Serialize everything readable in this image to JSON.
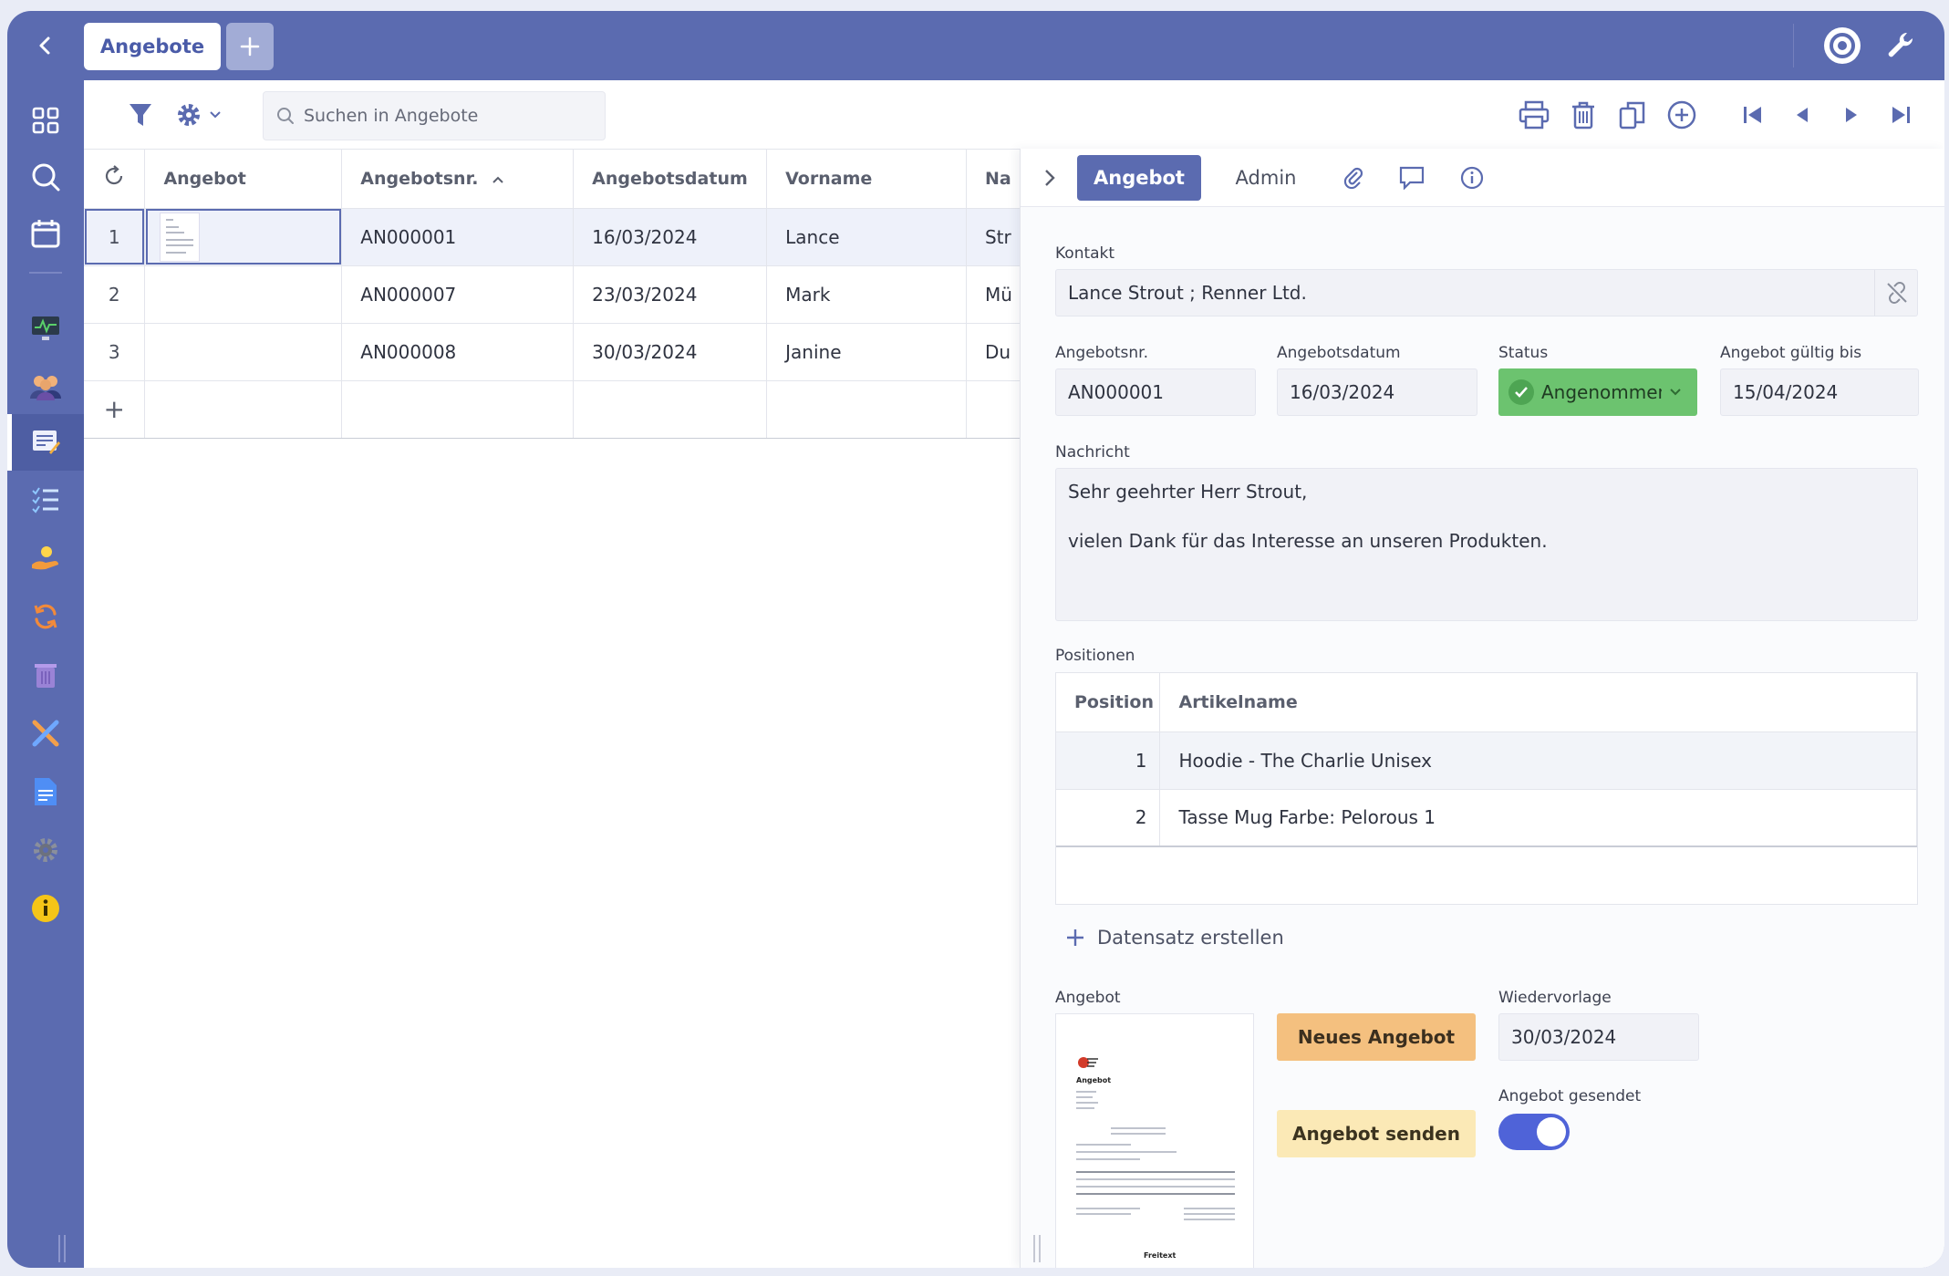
{
  "tabs": {
    "main_label": "Angebote"
  },
  "search": {
    "placeholder": "Suchen in Angebote"
  },
  "grid": {
    "columns": [
      "Angebot",
      "Angebotsnr.",
      "Angebotsdatum",
      "Vorname",
      "Na"
    ],
    "rows": [
      {
        "num": "1",
        "nr": "AN000001",
        "datum": "16/03/2024",
        "vorname": "Lance",
        "nachname": "Str"
      },
      {
        "num": "2",
        "nr": "AN000007",
        "datum": "23/03/2024",
        "vorname": "Mark",
        "nachname": "Mü"
      },
      {
        "num": "3",
        "nr": "AN000008",
        "datum": "30/03/2024",
        "vorname": "Janine",
        "nachname": "Du"
      }
    ],
    "add_symbol": "+"
  },
  "panel": {
    "tabs": {
      "angebot": "Angebot",
      "admin": "Admin"
    },
    "kontakt": {
      "label": "Kontakt",
      "value": "Lance Strout ; Renner Ltd."
    },
    "angebotsnr": {
      "label": "Angebotsnr.",
      "value": "AN000001"
    },
    "angebotsdatum": {
      "label": "Angebotsdatum",
      "value": "16/03/2024"
    },
    "status": {
      "label": "Status",
      "value": "Angenommen"
    },
    "gueltig": {
      "label": "Angebot gültig bis",
      "value": "15/04/2024"
    },
    "nachricht": {
      "label": "Nachricht",
      "line1": "Sehr geehrter Herr Strout,",
      "line2": "vielen Dank für das Interesse an unseren Produkten."
    },
    "positionen": {
      "label": "Positionen",
      "columns": [
        "Position",
        "Artikelname"
      ],
      "rows": [
        {
          "pos": "1",
          "name": "Hoodie - The Charlie Unisex"
        },
        {
          "pos": "2",
          "name": "Tasse Mug Farbe: Pelorous 1"
        }
      ],
      "create_label": "Datensatz erstellen"
    },
    "angebot_doc": {
      "label": "Angebot",
      "doc_title": "Angebot",
      "footer": "Freitext"
    },
    "buttons": {
      "neues_angebot": "Neues Angebot",
      "angebot_senden": "Angebot senden"
    },
    "wiedervorlage": {
      "label": "Wiedervorlage",
      "value": "30/03/2024"
    },
    "gesendet": {
      "label": "Angebot gesendet",
      "on": true
    }
  },
  "colors": {
    "brand": "#5b6bb0",
    "status_green": "#6cc36f",
    "button_orange": "#f4c07f",
    "button_yellow": "#fbe9b6",
    "toggle_blue": "#4f63d8"
  }
}
